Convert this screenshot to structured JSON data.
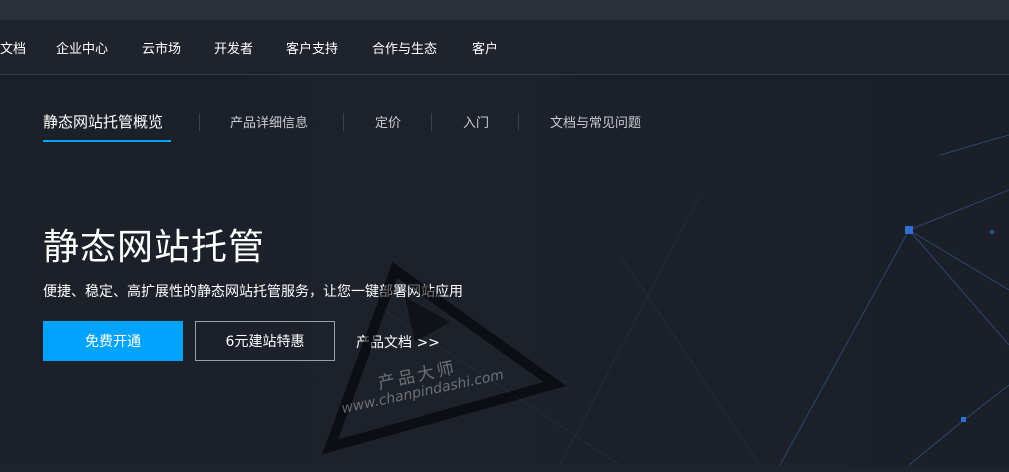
{
  "top_nav": {
    "items": [
      "文档",
      "企业中心",
      "云市场",
      "开发者",
      "客户支持",
      "合作与生态",
      "客户"
    ]
  },
  "sub_nav": {
    "tabs": [
      "静态网站托管概览",
      "产品详细信息",
      "定价",
      "入门",
      "文档与常见问题"
    ]
  },
  "hero": {
    "title": "静态网站托管",
    "description": "便捷、稳定、高扩展性的静态网站托管服务，让您一键部署网站应用",
    "primary_button": "免费开通",
    "secondary_button": "6元建站特惠",
    "doc_link": "产品文档 >>"
  },
  "watermark": {
    "line1": "产品大师",
    "line2": "www.chanpindashi.com"
  },
  "colors": {
    "accent": "#00a3ff",
    "background": "#1f232b"
  }
}
